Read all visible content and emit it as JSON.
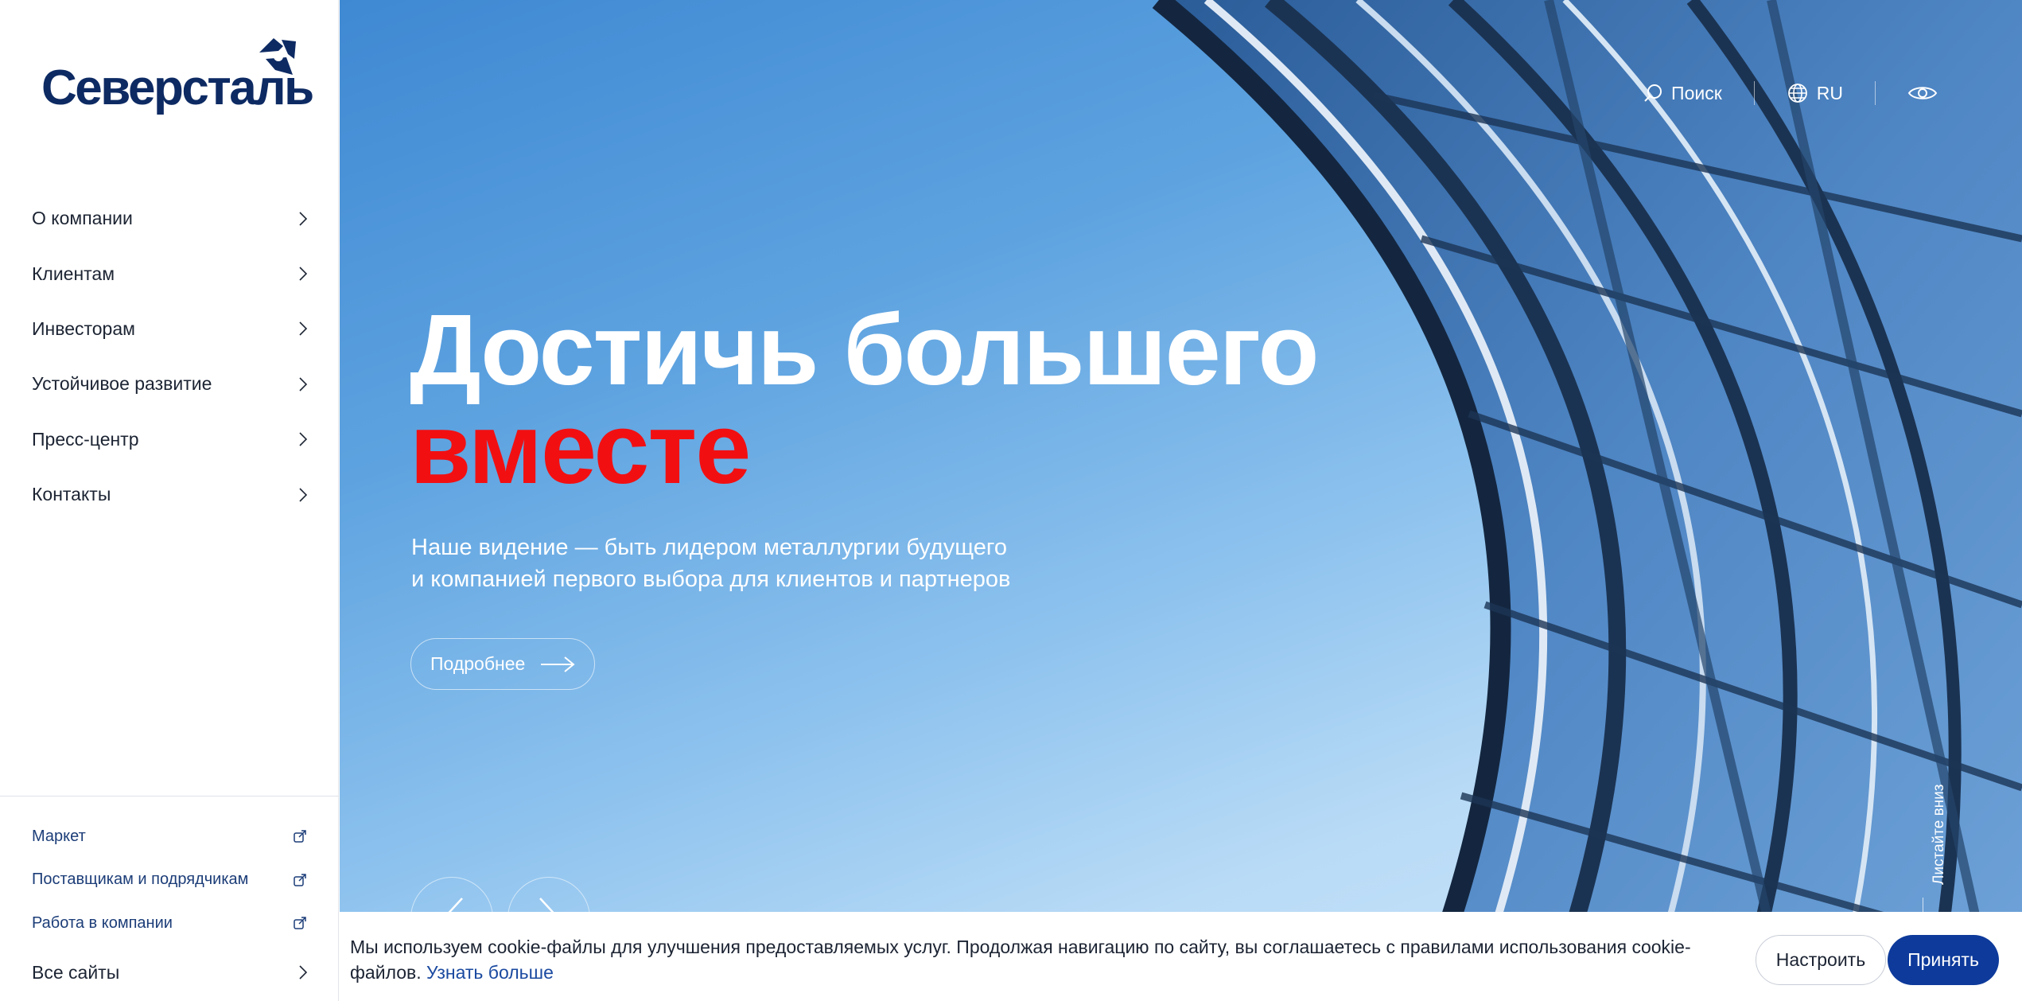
{
  "brand": {
    "name": "Северсталь",
    "color": "#0d2a63",
    "accent": "#f20f12",
    "primary_button": "#0d3a9b"
  },
  "sidebar": {
    "items": [
      {
        "label": "О компании"
      },
      {
        "label": "Клиентам"
      },
      {
        "label": "Инвесторам"
      },
      {
        "label": "Устойчивое развитие"
      },
      {
        "label": "Пресс-центр"
      },
      {
        "label": "Контакты"
      }
    ],
    "external_links": [
      {
        "label": "Маркет",
        "icon": "external-link-icon"
      },
      {
        "label": "Поставщикам и подрядчикам",
        "icon": "external-link-icon"
      },
      {
        "label": "Работа в компании",
        "icon": "external-link-icon"
      }
    ],
    "all_sites": "Все сайты"
  },
  "header": {
    "search_label": "Поиск",
    "language": "RU",
    "accessibility_icon": "eye-icon"
  },
  "hero": {
    "title_line1": "Достичь большего",
    "title_line2": "вместе",
    "subtitle_line1": "Наше видение — быть лидером металлургии будущего",
    "subtitle_line2": "и компанией первого выбора для клиентов и партнеров",
    "cta_label": "Подробнее",
    "scroll_hint": "Листайте вниз"
  },
  "cookie": {
    "text": "Мы используем cookie-файлы для улучшения предоставляемых услуг. Продолжая навигацию по сайту, вы соглашаетесь с правилами использования cookie-файлов.",
    "link": "Узнать больше",
    "settings_label": "Настроить",
    "accept_label": "Принять"
  }
}
